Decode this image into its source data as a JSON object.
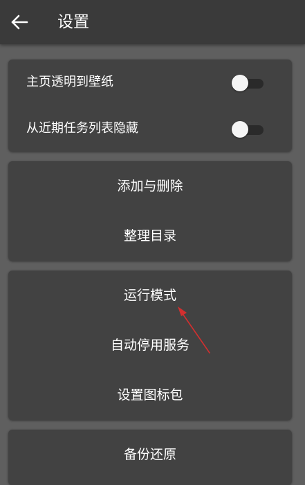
{
  "header": {
    "title": "设置",
    "back_icon": "arrow-left-icon"
  },
  "card_toggles": {
    "items": [
      {
        "label": "主页透明到壁纸",
        "checked": false
      },
      {
        "label": "从近期任务列表隐藏",
        "checked": false
      }
    ]
  },
  "card_edit": {
    "items": [
      "添加与删除",
      "整理目录"
    ]
  },
  "card_settings": {
    "items": [
      "运行模式",
      "自动停用服务",
      "设置图标包"
    ]
  },
  "card_backup": {
    "items": [
      "备份还原"
    ]
  },
  "colors": {
    "background": "#5f5f5f",
    "appbar": "#3a3a3a",
    "card": "#424242",
    "annotation_arrow": "#d32f2f"
  }
}
